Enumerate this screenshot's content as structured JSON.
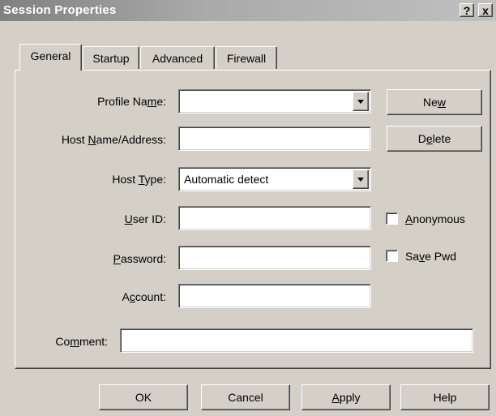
{
  "window": {
    "title": "Session Properties",
    "help_button": "?",
    "close_button": "x"
  },
  "tabs": [
    {
      "label": "General",
      "active": true
    },
    {
      "label": "Startup",
      "active": false
    },
    {
      "label": "Advanced",
      "active": false
    },
    {
      "label": "Firewall",
      "active": false
    }
  ],
  "form": {
    "profile_name": {
      "pre": "Profile Na",
      "mn": "m",
      "post": "e:",
      "value": ""
    },
    "host_name": {
      "pre": "Host ",
      "mn": "N",
      "post": "ame/Address:",
      "value": ""
    },
    "host_type": {
      "pre": "Host ",
      "mn": "T",
      "post": "ype:",
      "value": "Automatic detect"
    },
    "user_id": {
      "pre": "",
      "mn": "U",
      "post": "ser ID:",
      "value": ""
    },
    "password": {
      "pre": "",
      "mn": "P",
      "post": "assword:",
      "value": ""
    },
    "account": {
      "pre": "A",
      "mn": "c",
      "post": "count:",
      "value": ""
    },
    "comment": {
      "pre": "Co",
      "mn": "m",
      "post": "ment:",
      "value": ""
    }
  },
  "side_buttons": {
    "new": {
      "pre": "Ne",
      "mn": "w",
      "post": ""
    },
    "delete": {
      "pre": "D",
      "mn": "e",
      "post": "lete"
    }
  },
  "checkboxes": {
    "anonymous": {
      "pre": "",
      "mn": "A",
      "post": "nonymous",
      "checked": false
    },
    "save_pwd": {
      "pre": "Sa",
      "mn": "v",
      "post": "e Pwd",
      "checked": false
    }
  },
  "footer_buttons": {
    "ok": "OK",
    "cancel": "Cancel",
    "apply": {
      "pre": "",
      "mn": "A",
      "post": "pply"
    },
    "help": "Help"
  }
}
